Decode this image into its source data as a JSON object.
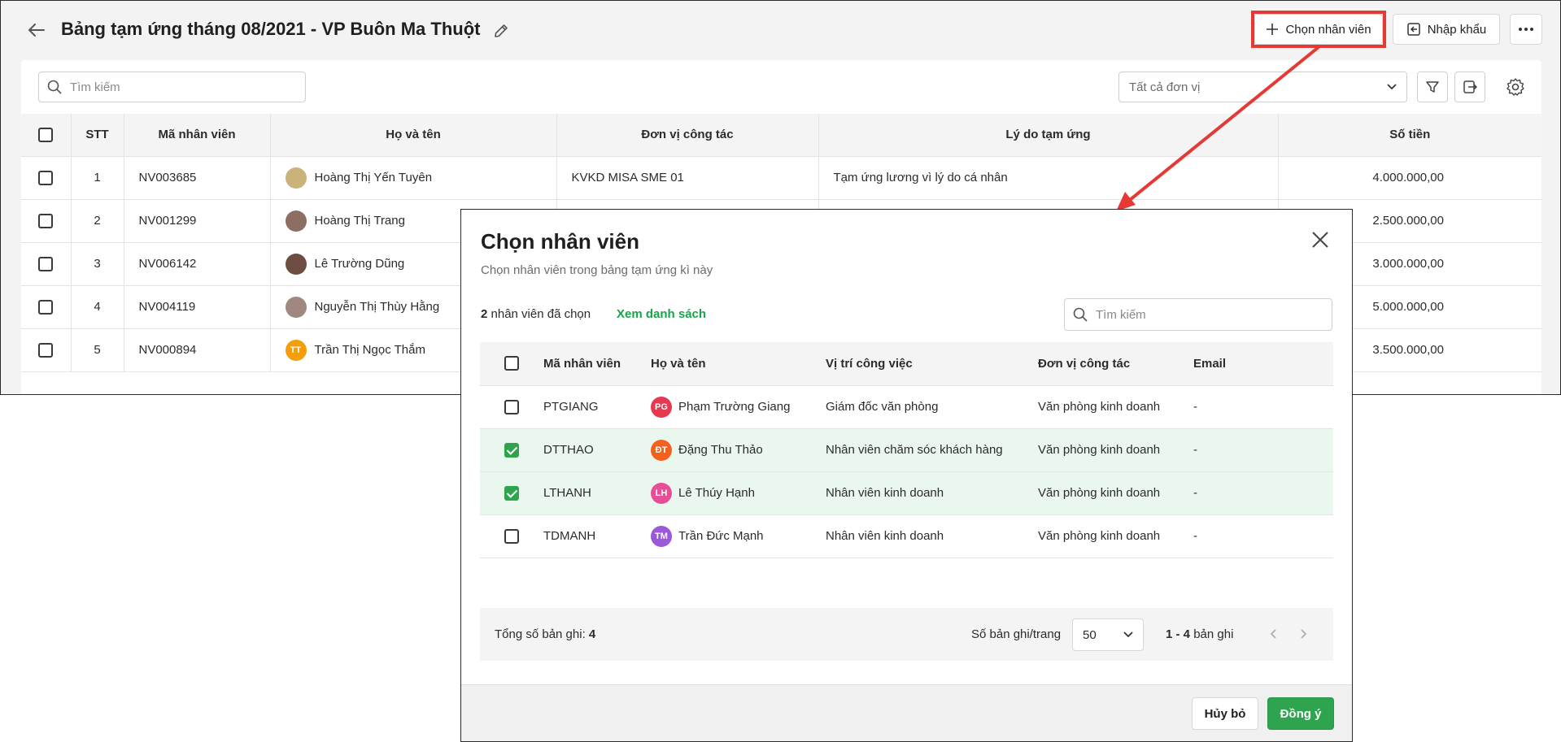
{
  "header": {
    "title": "Bảng tạm ứng tháng 08/2021 - VP Buôn Ma Thuột",
    "choose_employee_label": "Chọn nhân viên",
    "import_label": "Nhập khẩu"
  },
  "toolbar": {
    "search_placeholder": "Tìm kiếm",
    "unit_filter_value": "Tất cả đơn vị"
  },
  "main_table": {
    "columns": [
      "STT",
      "Mã nhân viên",
      "Họ và tên",
      "Đơn vị công tác",
      "Lý do tạm ứng",
      "Số tiền"
    ],
    "rows": [
      {
        "stt": "1",
        "code": "NV003685",
        "name": "Hoàng Thị Yến Tuyên",
        "unit": "KVKD MISA SME 01",
        "reason": "Tạm ứng lương vì lý do cá nhân",
        "amount": "4.000.000,00",
        "avatar_color": "#c9b37a"
      },
      {
        "stt": "2",
        "code": "NV001299",
        "name": "Hoàng Thị Trang",
        "unit": "",
        "reason": "",
        "amount": "2.500.000,00",
        "avatar_color": "#8d6e63"
      },
      {
        "stt": "3",
        "code": "NV006142",
        "name": "Lê Trường Dũng",
        "unit": "",
        "reason": "",
        "amount": "3.000.000,00",
        "avatar_color": "#6d4c41"
      },
      {
        "stt": "4",
        "code": "NV004119",
        "name": "Nguyễn Thị Thùy Hằng",
        "unit": "",
        "reason": "",
        "amount": "5.000.000,00",
        "avatar_color": "#a1887f"
      },
      {
        "stt": "5",
        "code": "NV000894",
        "name": "Trần Thị Ngọc Thắm",
        "unit": "",
        "reason": "",
        "amount": "3.500.000,00",
        "avatar_color": "#f59e0b",
        "avatar_initials": "TT"
      }
    ]
  },
  "modal": {
    "title": "Chọn nhân viên",
    "subtitle": "Chọn nhân viên trong bảng tạm ứng kì này",
    "selected_count": "2",
    "selected_suffix": "nhân viên đã chọn",
    "view_list_label": "Xem danh sách",
    "search_placeholder": "Tìm kiếm",
    "columns": [
      "Mã nhân viên",
      "Họ và tên",
      "Vị trí công việc",
      "Đơn vị công tác",
      "Email"
    ],
    "rows": [
      {
        "code": "PTGIANG",
        "initials": "PG",
        "name": "Phạm Trường Giang",
        "position": "Giám đốc văn phòng",
        "unit": "Văn phòng kinh doanh",
        "email": "-",
        "avatar_color": "#e53950",
        "checked": false
      },
      {
        "code": "DTTHAO",
        "initials": "ĐT",
        "name": "Đặng Thu Thảo",
        "position": "Nhân viên chăm sóc khách hàng",
        "unit": "Văn phòng kinh doanh",
        "email": "-",
        "avatar_color": "#f4611e",
        "checked": true
      },
      {
        "code": "LTHANH",
        "initials": "LH",
        "name": "Lê Thúy Hạnh",
        "position": "Nhân viên kinh doanh",
        "unit": "Văn phòng kinh doanh",
        "email": "-",
        "avatar_color": "#e84e97",
        "checked": true
      },
      {
        "code": "TDMANH",
        "initials": "TM",
        "name": "Trần Đức Mạnh",
        "position": "Nhân viên kinh doanh",
        "unit": "Văn phòng kinh doanh",
        "email": "-",
        "avatar_color": "#9b59d9",
        "checked": false
      }
    ],
    "footer": {
      "total_label": "Tổng số bản ghi:",
      "total_value": "4",
      "per_page_label": "Số bản ghi/trang",
      "per_page_value": "50",
      "range_value": "1 - 4",
      "range_suffix": "bản ghi"
    },
    "cancel_label": "Hủy bỏ",
    "ok_label": "Đồng ý"
  },
  "colors": {
    "accent_green": "#2ea44f",
    "highlight_red": "#e53935"
  }
}
